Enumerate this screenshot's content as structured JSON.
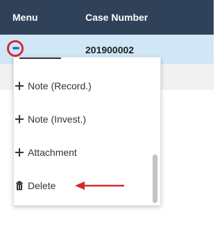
{
  "table": {
    "header": {
      "menu": "Menu",
      "case_number": "Case Number"
    },
    "row": {
      "case_number": "201900002"
    }
  },
  "menu": {
    "button_icon": "more-horizontal-icon",
    "items": [
      {
        "icon": "plus-icon",
        "label": "Note (Record.)"
      },
      {
        "icon": "plus-icon",
        "label": "Note (Invest.)"
      },
      {
        "icon": "plus-icon",
        "label": "Attachment"
      },
      {
        "icon": "trash-icon",
        "label": "Delete"
      }
    ]
  },
  "colors": {
    "header_bg": "#2f4259",
    "selected_row_bg": "#cfe7f7",
    "highlight_red": "#d42a2a",
    "dots_blue": "#2f6fb0"
  }
}
